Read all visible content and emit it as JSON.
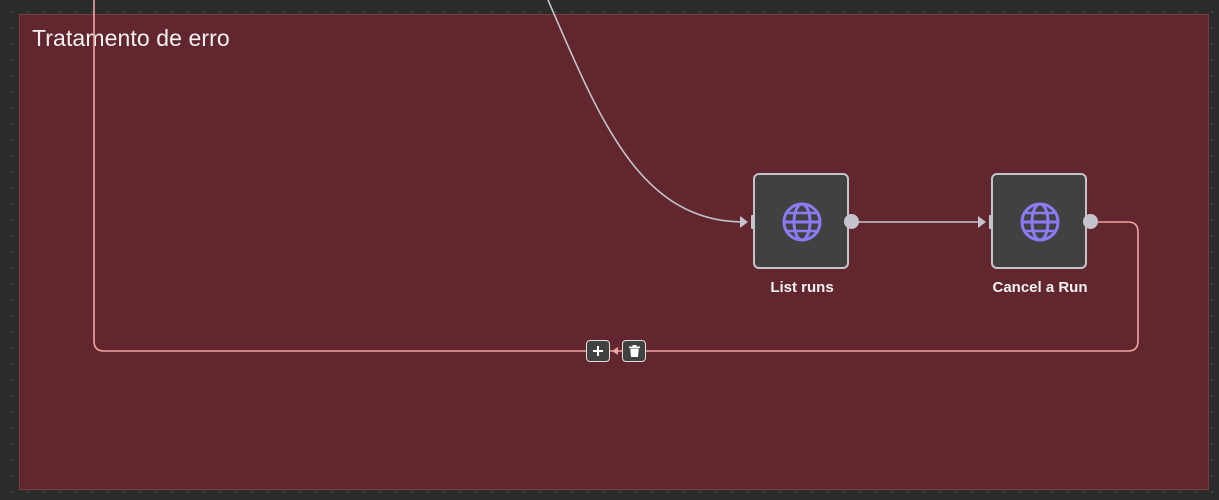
{
  "sticky": {
    "title": "Tratamento de erro"
  },
  "nodes": [
    {
      "id": "list-runs",
      "label": "List runs",
      "icon": "globe-icon"
    },
    {
      "id": "cancel-run",
      "label": "Cancel a Run",
      "icon": "globe-icon"
    }
  ],
  "edge_actions": {
    "add_icon": "plus-icon",
    "delete_icon": "trash-icon"
  },
  "colors": {
    "canvas_bg": "#2b2b2b",
    "sticky_bg": "#62272e",
    "node_bg": "#414141",
    "node_border": "#c4c4cc",
    "icon_accent": "#8b7cf6",
    "edge_default": "#c4c4cc",
    "edge_error": "#f0a4a0"
  }
}
